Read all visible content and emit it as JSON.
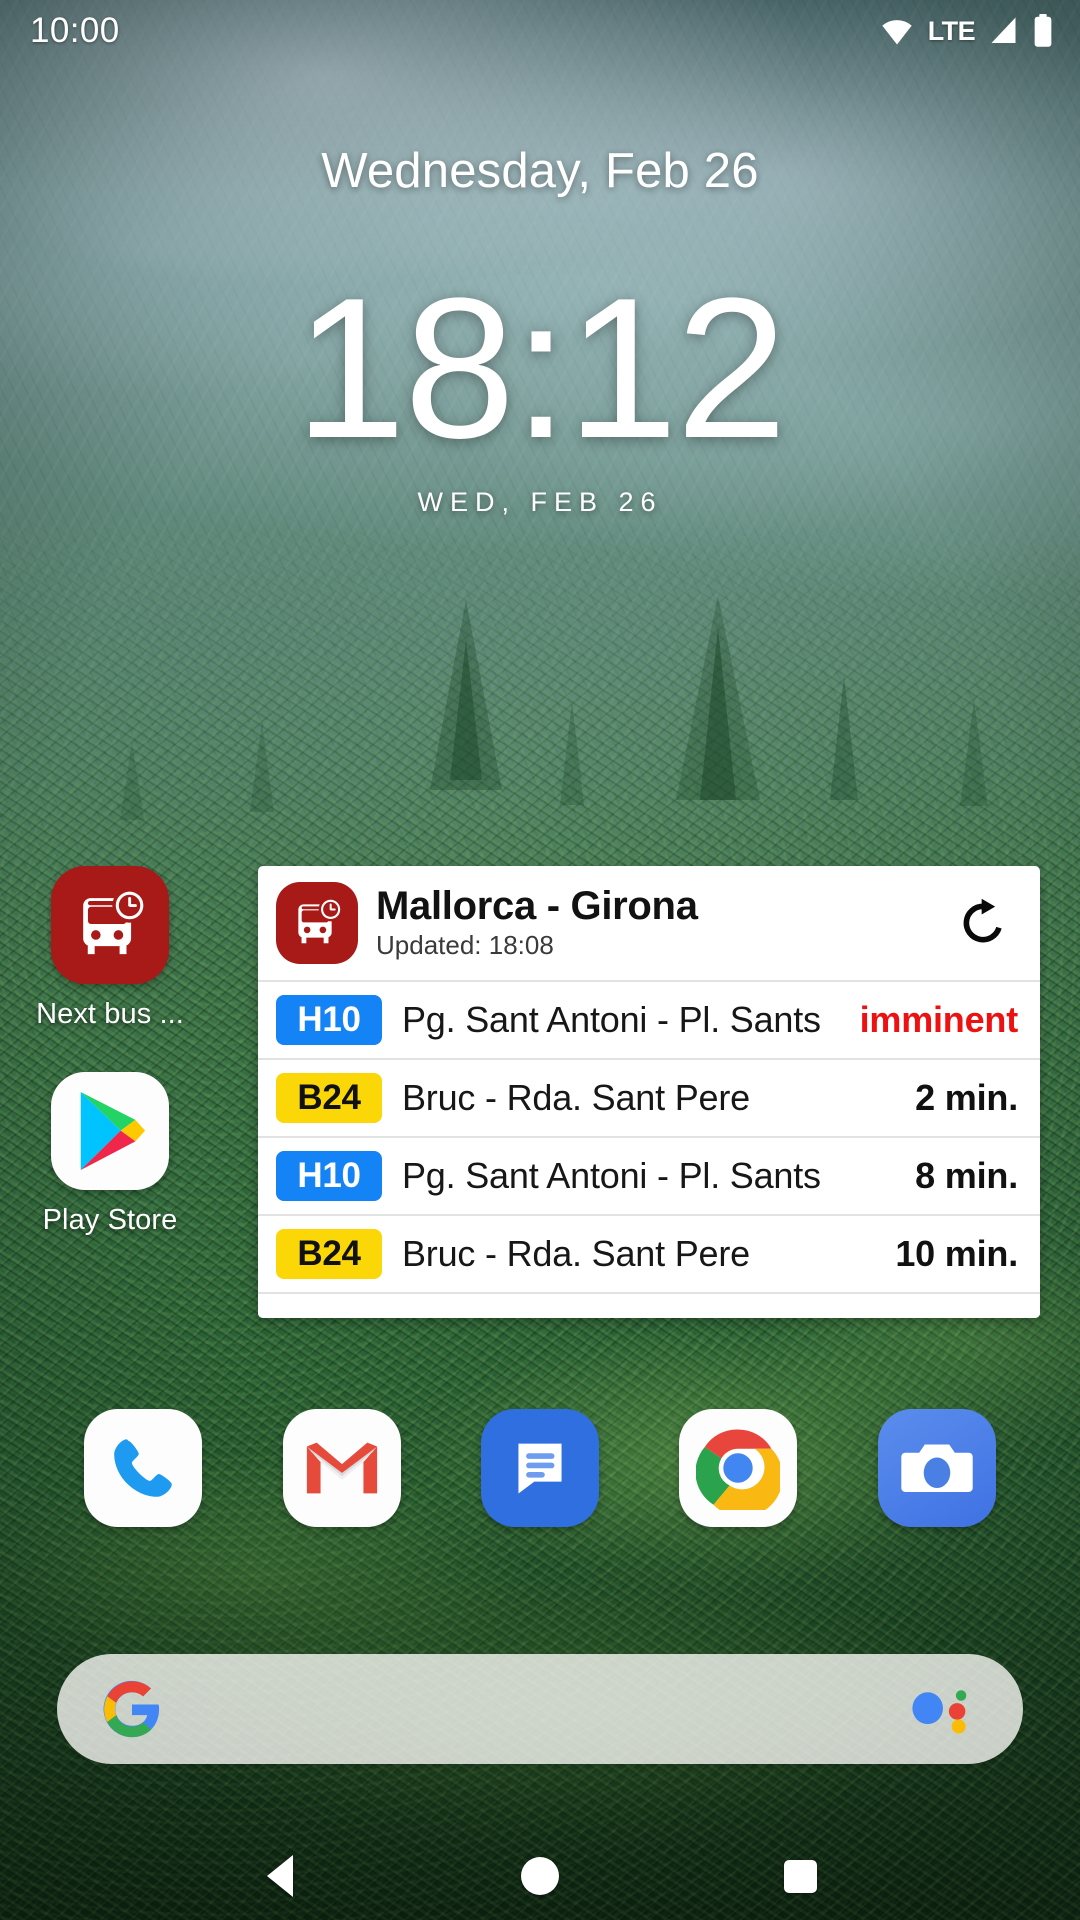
{
  "status_bar": {
    "clock": "10:00",
    "icons": [
      "wifi-icon",
      "lte-label",
      "signal-icon",
      "battery-icon"
    ],
    "network_label": "LTE"
  },
  "clock_widget": {
    "date_header": "Wednesday, Feb 26",
    "time": "18:12",
    "sub_date": "WED, FEB 26"
  },
  "home_icons": [
    {
      "label": "Next bus ...",
      "icon": "bus-clock-icon",
      "color": "#a81a17"
    },
    {
      "label": "Play Store",
      "icon": "play-store-icon",
      "color": "#ffffff"
    }
  ],
  "widget": {
    "icon": "bus-clock-icon",
    "title": "Mallorca - Girona",
    "updated": "Updated: 18:08",
    "refresh_icon": "refresh-icon",
    "accent_color": "#a81a17",
    "rows": [
      {
        "line": "H10",
        "badge_color": "#1383f5",
        "badge_text_color": "#ffffff",
        "destination": "Pg. Sant Antoni - Pl. Sants",
        "eta": "imminent",
        "urgent": true
      },
      {
        "line": "B24",
        "badge_color": "#fbd708",
        "badge_text_color": "#111111",
        "destination": "Bruc - Rda. Sant Pere",
        "eta": "2 min.",
        "urgent": false
      },
      {
        "line": "H10",
        "badge_color": "#1383f5",
        "badge_text_color": "#ffffff",
        "destination": "Pg. Sant Antoni - Pl. Sants",
        "eta": "8 min.",
        "urgent": false
      },
      {
        "line": "B24",
        "badge_color": "#fbd708",
        "badge_text_color": "#111111",
        "destination": "Bruc - Rda. Sant Pere",
        "eta": "10 min.",
        "urgent": false
      }
    ]
  },
  "dock": [
    {
      "name": "phone",
      "icon": "phone-icon"
    },
    {
      "name": "gmail",
      "icon": "gmail-icon"
    },
    {
      "name": "messages",
      "icon": "messages-icon"
    },
    {
      "name": "chrome",
      "icon": "chrome-icon"
    },
    {
      "name": "camera",
      "icon": "camera-icon"
    }
  ],
  "search_bar": {
    "leading_icon": "google-g-icon",
    "trailing_icon": "google-assistant-icon",
    "query": ""
  },
  "nav_bar": {
    "back": "back-icon",
    "home": "home-icon",
    "recents": "recents-icon"
  }
}
